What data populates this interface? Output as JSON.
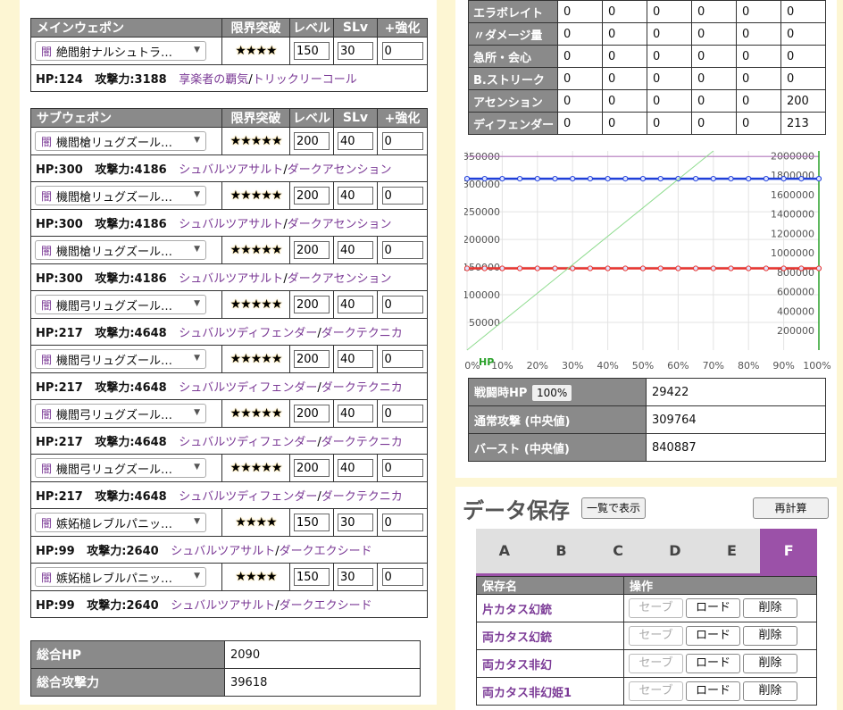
{
  "colors": {
    "header_bg": "#8a8a8a",
    "accent": "#9b51a8",
    "skill": "#7b3a96",
    "page_bg": "#fdf6d3"
  },
  "main_weapon": {
    "headers": [
      "メインウェポン",
      "限界突破",
      "レベル",
      "SLv",
      "+強化"
    ],
    "row": {
      "tag": "闇",
      "name": "絶閻射ナルシュトラール",
      "stars": "★★★★",
      "level": "150",
      "slv": "30",
      "plus": "0",
      "hp_label": "HP:124",
      "atk_label": "攻撃力:3188",
      "skill1": "享楽者の覇気",
      "skill2": "トリックリーコール"
    }
  },
  "sub_weapon": {
    "headers": [
      "サブウェポン",
      "限界突破",
      "レベル",
      "SLv",
      "+強化"
    ],
    "rows": [
      {
        "tag": "闇",
        "name": "機閻槍リュグズールスピア",
        "stars": "★★★★★",
        "level": "200",
        "slv": "40",
        "plus": "0",
        "hp_label": "HP:300",
        "atk_label": "攻撃力:4186",
        "skill1": "シュバルツアサルト",
        "skill2": "ダークアセンション"
      },
      {
        "tag": "闇",
        "name": "機閻槍リュグズールスピア",
        "stars": "★★★★★",
        "level": "200",
        "slv": "40",
        "plus": "0",
        "hp_label": "HP:300",
        "atk_label": "攻撃力:4186",
        "skill1": "シュバルツアサルト",
        "skill2": "ダークアセンション"
      },
      {
        "tag": "闇",
        "name": "機閻槍リュグズールスピア",
        "stars": "★★★★★",
        "level": "200",
        "slv": "40",
        "plus": "0",
        "hp_label": "HP:300",
        "atk_label": "攻撃力:4186",
        "skill1": "シュバルツアサルト",
        "skill2": "ダークアセンション"
      },
      {
        "tag": "闇",
        "name": "機閻弓リュグズールボウ",
        "stars": "★★★★★",
        "level": "200",
        "slv": "40",
        "plus": "0",
        "hp_label": "HP:217",
        "atk_label": "攻撃力:4648",
        "skill1": "シュバルツディフェンダー",
        "skill2": "ダークテクニカ"
      },
      {
        "tag": "闇",
        "name": "機閻弓リュグズールボウ",
        "stars": "★★★★★",
        "level": "200",
        "slv": "40",
        "plus": "0",
        "hp_label": "HP:217",
        "atk_label": "攻撃力:4648",
        "skill1": "シュバルツディフェンダー",
        "skill2": "ダークテクニカ"
      },
      {
        "tag": "闇",
        "name": "機閻弓リュグズールボウ",
        "stars": "★★★★★",
        "level": "200",
        "slv": "40",
        "plus": "0",
        "hp_label": "HP:217",
        "atk_label": "攻撃力:4648",
        "skill1": "シュバルツディフェンダー",
        "skill2": "ダークテクニカ"
      },
      {
        "tag": "闇",
        "name": "機閻弓リュグズールボウ",
        "stars": "★★★★★",
        "level": "200",
        "slv": "40",
        "plus": "0",
        "hp_label": "HP:217",
        "atk_label": "攻撃力:4648",
        "skill1": "シュバルツディフェンダー",
        "skill2": "ダークテクニカ"
      },
      {
        "tag": "闇",
        "name": "嫉妬槌レブルパニッシャー",
        "stars": "★★★★",
        "level": "150",
        "slv": "30",
        "plus": "0",
        "hp_label": "HP:99",
        "atk_label": "攻撃力:2640",
        "skill1": "シュバルツアサルト",
        "skill2": "ダークエクシード"
      },
      {
        "tag": "闇",
        "name": "嫉妬槌レブルパニッシャー",
        "stars": "★★★★",
        "level": "150",
        "slv": "30",
        "plus": "0",
        "hp_label": "HP:99",
        "atk_label": "攻撃力:2640",
        "skill1": "シュバルツアサルト",
        "skill2": "ダークエクシード"
      }
    ]
  },
  "totals": [
    {
      "label": "総合HP",
      "value": "2090"
    },
    {
      "label": "総合攻撃力",
      "value": "39618"
    }
  ],
  "modifiers": [
    {
      "label": "エラボレイト",
      "values": [
        "0",
        "0",
        "0",
        "0",
        "0",
        "0"
      ]
    },
    {
      "label": "〃ダメージ量",
      "values": [
        "0",
        "0",
        "0",
        "0",
        "0",
        "0"
      ]
    },
    {
      "label": "急所・会心",
      "values": [
        "0",
        "0",
        "0",
        "0",
        "0",
        "0"
      ]
    },
    {
      "label": "B.ストリーク",
      "values": [
        "0",
        "0",
        "0",
        "0",
        "0",
        "0"
      ]
    },
    {
      "label": "アセンション",
      "values": [
        "0",
        "0",
        "0",
        "0",
        "0",
        "200"
      ]
    },
    {
      "label": "ディフェンダー",
      "values": [
        "0",
        "0",
        "0",
        "0",
        "0",
        "213"
      ]
    }
  ],
  "chart_data": {
    "type": "line",
    "x_ticks": [
      "0%",
      "10%",
      "20%",
      "30%",
      "40%",
      "50%",
      "60%",
      "70%",
      "80%",
      "90%",
      "100%"
    ],
    "x_label": "HP",
    "y_left": {
      "min": 0,
      "max": 360000,
      "ticks": [
        "50000",
        "100000",
        "150000",
        "200000",
        "250000",
        "300000",
        "350000"
      ]
    },
    "y_right": {
      "min": 0,
      "max": 2050000,
      "ticks": [
        "200000",
        "400000",
        "600000",
        "800000",
        "1000000",
        "1200000",
        "1400000",
        "1600000",
        "1800000",
        "2000000"
      ]
    },
    "series": [
      {
        "color": "#1f3fd9",
        "axis": "left",
        "values": [
          309764,
          309764,
          309764,
          309764,
          309764,
          309764,
          309764,
          309764,
          309764,
          309764,
          309764,
          309764,
          309764,
          309764,
          309764,
          309764,
          309764,
          309764,
          309764,
          309764,
          309764
        ]
      },
      {
        "color": "#e8342f",
        "axis": "right",
        "values": [
          840887,
          840887,
          840887,
          840887,
          840887,
          840887,
          840887,
          840887,
          840887,
          840887,
          840887,
          840887,
          840887,
          840887,
          840887,
          840887,
          840887,
          840887,
          840887,
          840887,
          840887
        ]
      },
      {
        "color": "#8fdc8f",
        "axis": "left",
        "x": [
          0,
          70
        ],
        "values": [
          0,
          360000
        ]
      }
    ],
    "h_lines": [
      {
        "axis": "left",
        "value": 350000,
        "color": "#b77bbf"
      }
    ],
    "v_lines": [
      {
        "x": 100,
        "color": "#2aa12a"
      }
    ]
  },
  "results": {
    "hp_label": "戦闘時HP",
    "hp_button": "100%",
    "hp_value": "29422",
    "normal_label": "通常攻撃 (中央値)",
    "normal_value": "309764",
    "burst_label": "バースト (中央値)",
    "burst_value": "840887"
  },
  "save": {
    "title": "データ保存",
    "list_button": "一覧で表示",
    "recalc_button": "再計算",
    "tabs": [
      "A",
      "B",
      "C",
      "D",
      "E",
      "F"
    ],
    "active_tab": "F",
    "headers": [
      "保存名",
      "操作"
    ],
    "save_label": "セーブ",
    "load_label": "ロード",
    "delete_label": "削除",
    "entries": [
      "片カタス幻銃",
      "両カタス幻銃",
      "両カタス非幻",
      "両カタス非幻姫1"
    ]
  }
}
